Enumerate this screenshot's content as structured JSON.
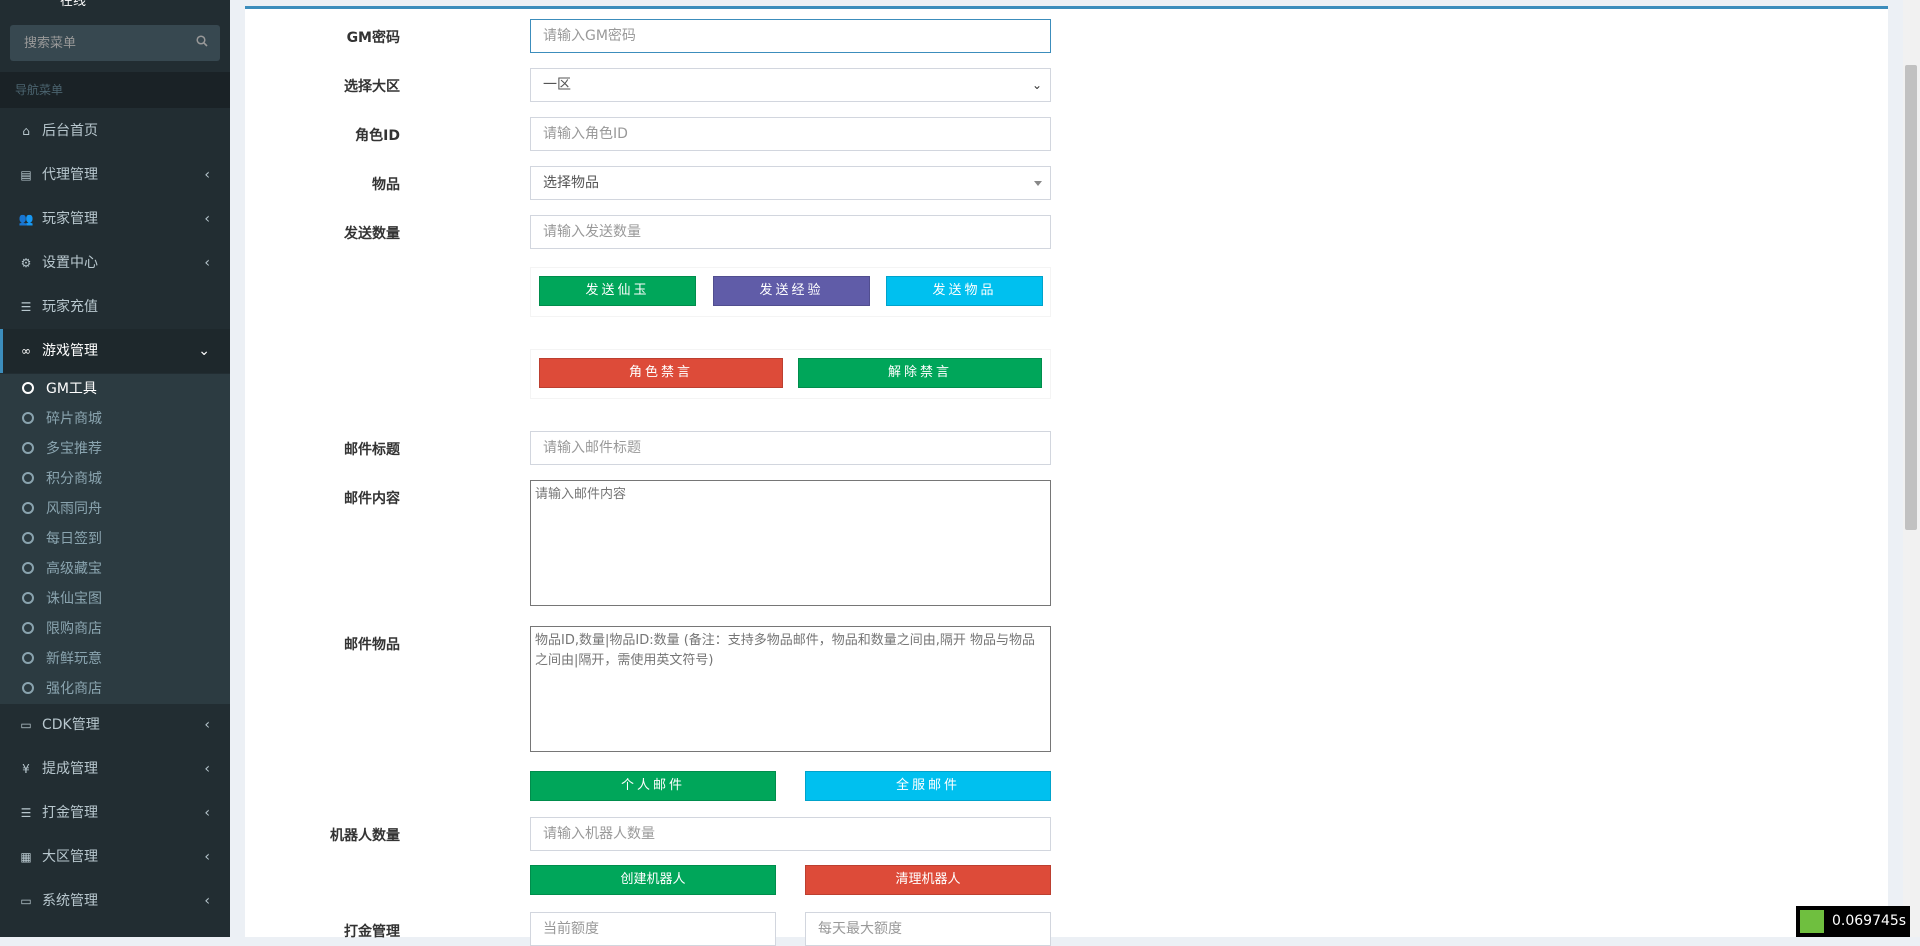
{
  "sidebar": {
    "top_text": "在线",
    "search": {
      "placeholder": "搜索菜单"
    },
    "header": "导航菜单",
    "items": [
      {
        "label": "后台首页",
        "icon": "home-icon",
        "glyph": "⌂"
      },
      {
        "label": "代理管理",
        "icon": "id-card-icon",
        "glyph": "▤"
      },
      {
        "label": "玩家管理",
        "icon": "users-icon",
        "glyph": "👥"
      },
      {
        "label": "设置中心",
        "icon": "gears-icon",
        "glyph": "⚙"
      },
      {
        "label": "玩家充值",
        "icon": "list-icon",
        "glyph": "☰"
      },
      {
        "label": "游戏管理",
        "icon": "gamepad-icon",
        "glyph": "∞"
      },
      {
        "label": "CDK管理",
        "icon": "credit-card-icon",
        "glyph": "▭"
      },
      {
        "label": "提成管理",
        "icon": "yen-icon",
        "glyph": "¥"
      },
      {
        "label": "打金管理",
        "icon": "list-icon",
        "glyph": "☰"
      },
      {
        "label": "大区管理",
        "icon": "th-large-icon",
        "glyph": "▦"
      },
      {
        "label": "系统管理",
        "icon": "desktop-icon",
        "glyph": "▭"
      }
    ],
    "submenu": [
      "GM工具",
      "碎片商城",
      "多宝推荐",
      "积分商城",
      "风雨同舟",
      "每日签到",
      "高级藏宝",
      "诛仙宝图",
      "限购商店",
      "新鲜玩意",
      "强化商店"
    ],
    "expand_glyph": "‹",
    "expanded_glyph": "⌄"
  },
  "form": {
    "gm_password": {
      "label": "GM密码",
      "placeholder": "请输入GM密码"
    },
    "region": {
      "label": "选择大区",
      "value": "一区"
    },
    "role_id": {
      "label": "角色ID",
      "placeholder": "请输入角色ID"
    },
    "item": {
      "label": "物品",
      "value": "选择物品"
    },
    "send_count": {
      "label": "发送数量",
      "placeholder": "请输入发送数量"
    },
    "buttons1": [
      "发送仙玉",
      "发送经验",
      "发送物品"
    ],
    "buttons2": [
      "角色禁言",
      "解除禁言"
    ],
    "mail_title": {
      "label": "邮件标题",
      "placeholder": "请输入邮件标题"
    },
    "mail_content": {
      "label": "邮件内容",
      "placeholder": "请输入邮件内容"
    },
    "mail_items": {
      "label": "邮件物品",
      "placeholder": "物品ID,数量|物品ID:数量 (备注：支持多物品邮件，物品和数量之间由,隔开 物品与物品之间由|隔开，需使用英文符号)"
    },
    "buttons3": [
      "个人邮件",
      "全服邮件"
    ],
    "robot_count": {
      "label": "机器人数量",
      "placeholder": "请输入机器人数量"
    },
    "buttons4": [
      "创建机器人",
      "清理机器人"
    ],
    "gold": {
      "label": "打金管理",
      "placeholder_current": "当前额度",
      "placeholder_max": "每天最大额度"
    }
  },
  "timer": "0.069745s",
  "colors": {
    "green": "#00a65a",
    "purple": "#605ca8",
    "aqua": "#00c0ef",
    "red": "#dd4b39",
    "sidebar": "#222d32",
    "accent": "#3c8dbc"
  }
}
